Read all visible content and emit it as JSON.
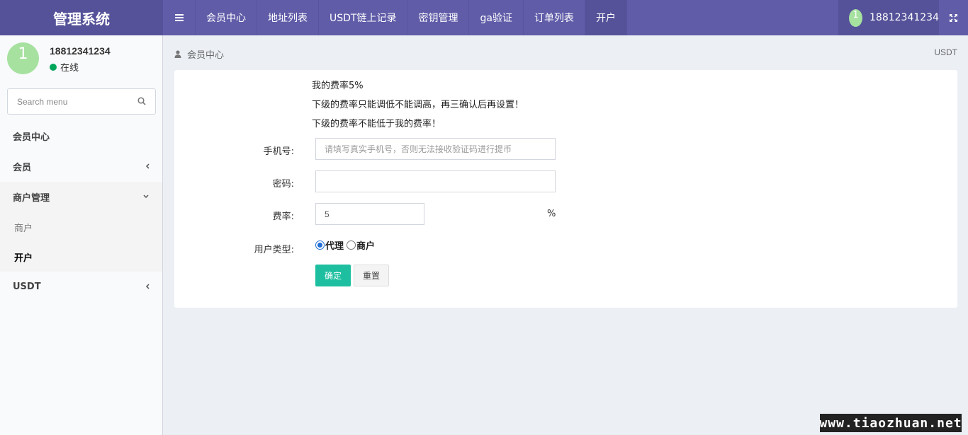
{
  "brand": "管理系统",
  "nav": [
    "会员中心",
    "地址列表",
    "USDT链上记录",
    "密钥管理",
    "ga验证",
    "订单列表",
    "开户"
  ],
  "user": {
    "avatar_letter": "1",
    "phone": "18812341234",
    "status": "在线"
  },
  "search": {
    "placeholder": "Search menu"
  },
  "menu": {
    "member_center": "会员中心",
    "member": "会员",
    "merchant_mgmt": "商户管理",
    "merchant": "商户",
    "open_account": "开户",
    "usdt": "USDT"
  },
  "breadcrumb": {
    "current": "会员中心",
    "right": "USDT"
  },
  "form": {
    "notes": [
      "我的费率5%",
      "下级的费率只能调低不能调高，再三确认后再设置！",
      "下级的费率不能低于我的费率！"
    ],
    "phone_label": "手机号:",
    "phone_placeholder": "请填写真实手机号，否则无法接收验证码进行提币",
    "password_label": "密码:",
    "rate_label": "费率:",
    "rate_value": "5",
    "rate_unit": "%",
    "type_label": "用户类型:",
    "type_agent": "代理",
    "type_merchant": "商户",
    "selected_type": "代理",
    "submit": "确定",
    "reset": "重置"
  },
  "watermark": "www.tiaozhuan.net",
  "colors": {
    "header": "#605ca8",
    "accent": "#1ebfa0",
    "online": "#00a65a"
  }
}
